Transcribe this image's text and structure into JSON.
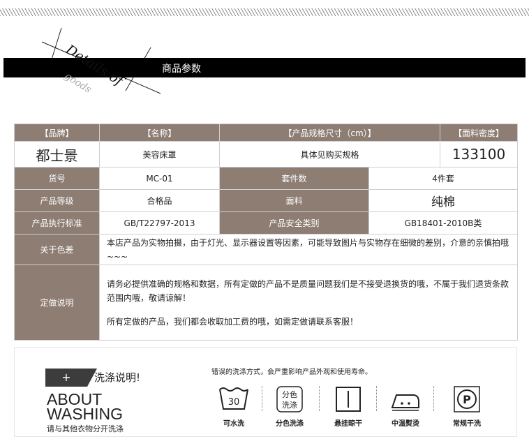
{
  "banner": {
    "details_main": "Details of",
    "details_sub": "goods",
    "section_title": "商品参数"
  },
  "params": {
    "header": [
      "【品牌】",
      "【名称】",
      "【产品规格尺寸（cm）】",
      "【面料密度】"
    ],
    "row1": [
      "都士景",
      "美容床罩",
      "具体见购买规格",
      "133100"
    ],
    "rows": [
      [
        "货号",
        "MC-01",
        "套件数",
        "4件套"
      ],
      [
        "产品等级",
        "合格品",
        "面料",
        "纯棉"
      ],
      [
        "产品执行标准",
        "GB/T22797-2013",
        "产品安全类别",
        "GB18401-2010B类"
      ]
    ],
    "color_label": "关于色差",
    "color_text": "本店产品为实物拍摄，由于灯光、显示器设置等因素，可能导致图片与实物存在细微的差别，介意的亲慎拍哦~~~",
    "custom_label": "定做说明",
    "custom_text_1": "请务必提供准确的规格和数据，所有定做的产品不是质量问题我们是不接受退换货的哦，不属于我们退货条款范围内哦，敬请谅解！",
    "custom_text_2": "所有定做的产品，我们都会收取加工费的哦，如需定做请联系客服！"
  },
  "washing": {
    "plus": "+",
    "title": "洗涤说明!",
    "about_line1": "ABOUT",
    "about_line2": "WASHING",
    "note": "请与其他衣物分开洗涤",
    "warning": "错误的洗涤方式，会严重影响产品外观和使用寿命。",
    "tub_temp": "30",
    "separate_line1": "分色",
    "separate_line2": "洗涤",
    "dry_p": "P",
    "icons": [
      {
        "icon": "washtub-30-icon",
        "label": "可水洗"
      },
      {
        "icon": "separate-color-icon",
        "label": "分色洗涤"
      },
      {
        "icon": "hang-dry-icon",
        "label": "悬挂晾干"
      },
      {
        "icon": "iron-medium-icon",
        "label": "中温熨烫"
      },
      {
        "icon": "dry-clean-p-icon",
        "label": "常规干洗"
      }
    ]
  }
}
